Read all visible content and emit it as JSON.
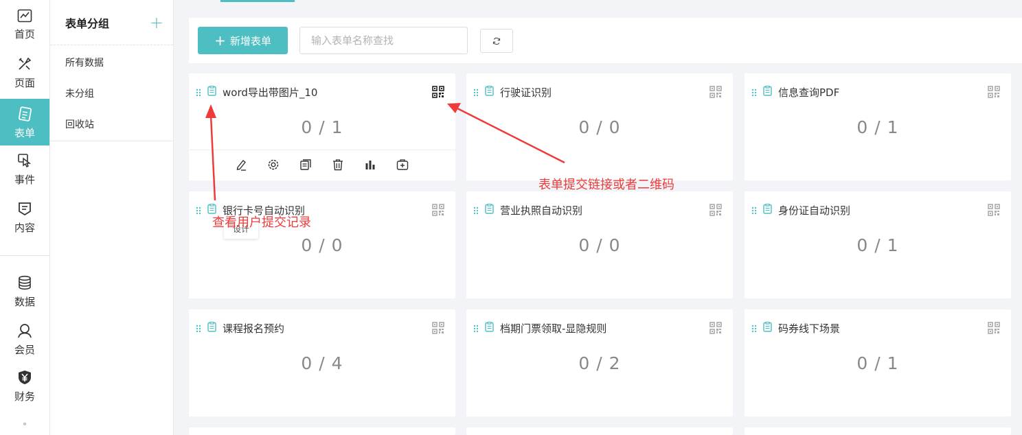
{
  "nav": {
    "items": [
      {
        "label": "首页",
        "icon": "chart-line-icon"
      },
      {
        "label": "页面",
        "icon": "design-tools-icon"
      },
      {
        "label": "表单",
        "icon": "form-list-icon"
      },
      {
        "label": "事件",
        "icon": "hand-pointer-icon"
      },
      {
        "label": "内容",
        "icon": "content-shield-icon"
      },
      {
        "label": "数据",
        "icon": "database-icon"
      },
      {
        "label": "会员",
        "icon": "user-icon"
      },
      {
        "label": "财务",
        "icon": "yen-shield-icon"
      }
    ],
    "active": "表单",
    "colors": {
      "accent": "#4dbfc3"
    }
  },
  "groups": {
    "title": "表单分组",
    "add_icon": "plus-icon",
    "items": [
      "所有数据",
      "未分组",
      "回收站"
    ]
  },
  "toolbar": {
    "new_label": "新增表单",
    "search_placeholder": "输入表单名称查找",
    "refresh_icon": "refresh-icon"
  },
  "forms": [
    {
      "name": "word导出带图片_10",
      "count": "0 / 1"
    },
    {
      "name": "行驶证识别",
      "count": "0 / 0"
    },
    {
      "name": "信息查询PDF",
      "count": "0 / 1"
    },
    {
      "name": "银行卡号自动识别",
      "count": "0 / 0"
    },
    {
      "name": "营业执照自动识别",
      "count": "0 / 0"
    },
    {
      "name": "身份证自动识别",
      "count": "0 / 1"
    },
    {
      "name": "课程报名预约",
      "count": "0 / 4"
    },
    {
      "name": "档期门票领取-显隐规则",
      "count": "0 / 2"
    },
    {
      "name": "码券线下场景",
      "count": "0 / 1"
    }
  ],
  "card_actions": [
    "edit-icon",
    "settings-icon",
    "copy-icon",
    "delete-icon",
    "stats-icon",
    "add-to-icon"
  ],
  "tooltip": "设计",
  "annotations": {
    "qr_note": "表单提交链接或者二维码",
    "records_note": "查看用户提交记录",
    "color": "#f03a3a"
  }
}
